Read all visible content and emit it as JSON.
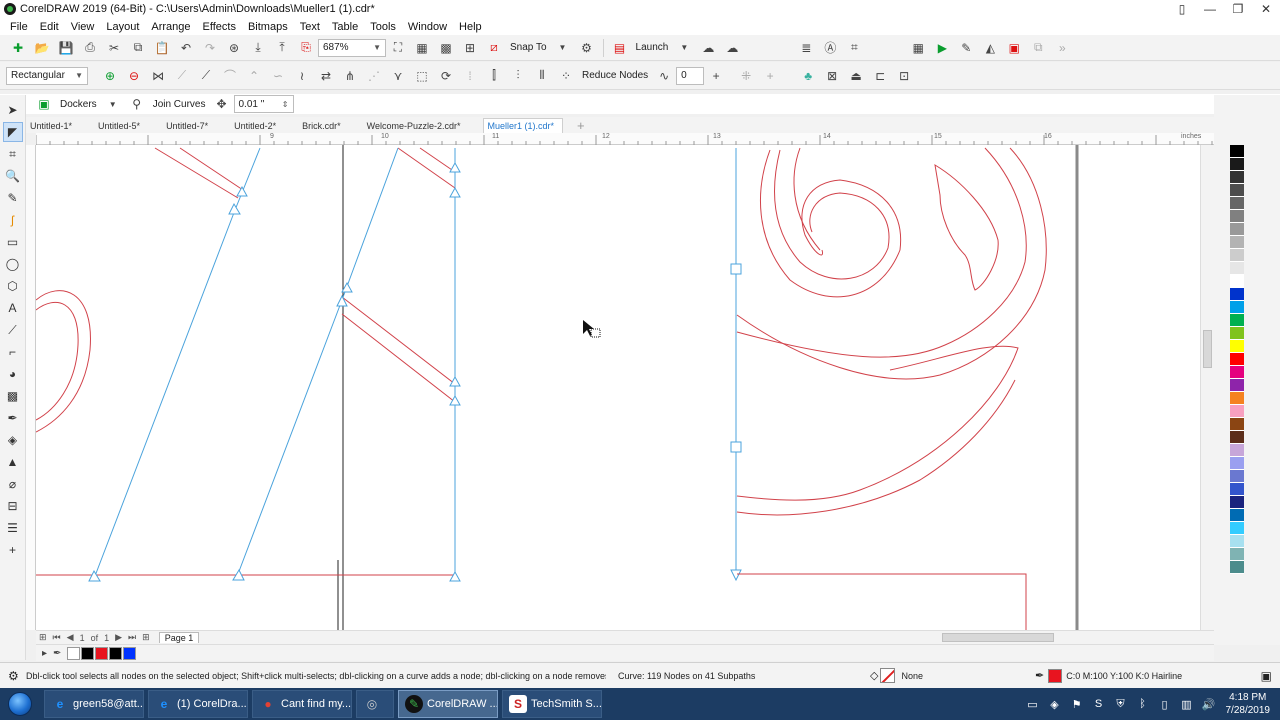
{
  "window": {
    "title": "CorelDRAW 2019 (64-Bit) - C:\\Users\\Admin\\Downloads\\Mueller1 (1).cdr*",
    "controls": [
      "▯",
      "—",
      "❐",
      "✕"
    ]
  },
  "menu": [
    "File",
    "Edit",
    "View",
    "Layout",
    "Arrange",
    "Effects",
    "Bitmaps",
    "Text",
    "Table",
    "Tools",
    "Window",
    "Help"
  ],
  "toolbar1": {
    "zoom": "687%",
    "snap_to": "Snap To",
    "launch": "Launch"
  },
  "toolbar2": {
    "selection_mode": "Rectangular",
    "reduce_nodes": "Reduce Nodes",
    "smoothness": "0"
  },
  "toolbar3": {
    "dockers": "Dockers",
    "join_curves": "Join Curves",
    "nudge": "0.01 \""
  },
  "tabs": [
    "Untitled-1*",
    "Untitled-5*",
    "Untitled-7*",
    "Untitled-2*",
    "Brick.cdr*",
    "Welcome-Puzzle-2.cdr*",
    "Mueller1 (1).cdr*"
  ],
  "active_tab_index": 6,
  "ruler": {
    "units": "inches",
    "labels": [
      "9",
      "10",
      "11",
      "12",
      "13",
      "14",
      "15",
      "16"
    ]
  },
  "page_nav": {
    "current": "1",
    "of": "of",
    "total": "1",
    "page_label": "Page 1"
  },
  "palette_colors": [
    "#000000",
    "#1a1a1a",
    "#333333",
    "#4d4d4d",
    "#666666",
    "#808080",
    "#999999",
    "#b3b3b3",
    "#cccccc",
    "#e6e6e6",
    "#ffffff",
    "#0033cc",
    "#00a0e9",
    "#00b050",
    "#7fc31c",
    "#ffff00",
    "#ff0000",
    "#e5007f",
    "#8e24aa",
    "#f58220",
    "#f8a0c0",
    "#8b4513",
    "#5c2e1a",
    "#c7a6d9",
    "#9a9ff0",
    "#6a78d0",
    "#3355cc",
    "#1a237e",
    "#006bb3",
    "#33ccff",
    "#a7e0f0",
    "#7fb3b3",
    "#4c8c8c"
  ],
  "doc_palette": [
    "#000000",
    "#e8141f",
    "#000000",
    "#0033ff"
  ],
  "status": {
    "hint": "Dbl-click tool selects all nodes on the selected object; Shift+click multi-selects; dbl-clicking on a curve adds a node; dbl-clicking on a node removes it",
    "info": "Curve: 119 Nodes on 41 Subpaths",
    "fill": "None",
    "outline": "C:0 M:100 Y:100 K:0  Hairline"
  },
  "taskbar": {
    "items": [
      {
        "label": "green58@att...",
        "icon": "e",
        "color": "#1e90ff"
      },
      {
        "label": "(1) CorelDra...",
        "icon": "e",
        "color": "#1e90ff"
      },
      {
        "label": "Cant find my...",
        "icon": "●",
        "color": "#e34133"
      },
      {
        "label": "",
        "icon": "◎",
        "color": "#888888"
      },
      {
        "label": "CorelDRAW ...",
        "icon": "✎",
        "color": "#111111"
      },
      {
        "label": "TechSmith S...",
        "icon": "S",
        "color": "#cc2222"
      }
    ],
    "time": "4:18 PM",
    "date": "7/28/2019"
  }
}
